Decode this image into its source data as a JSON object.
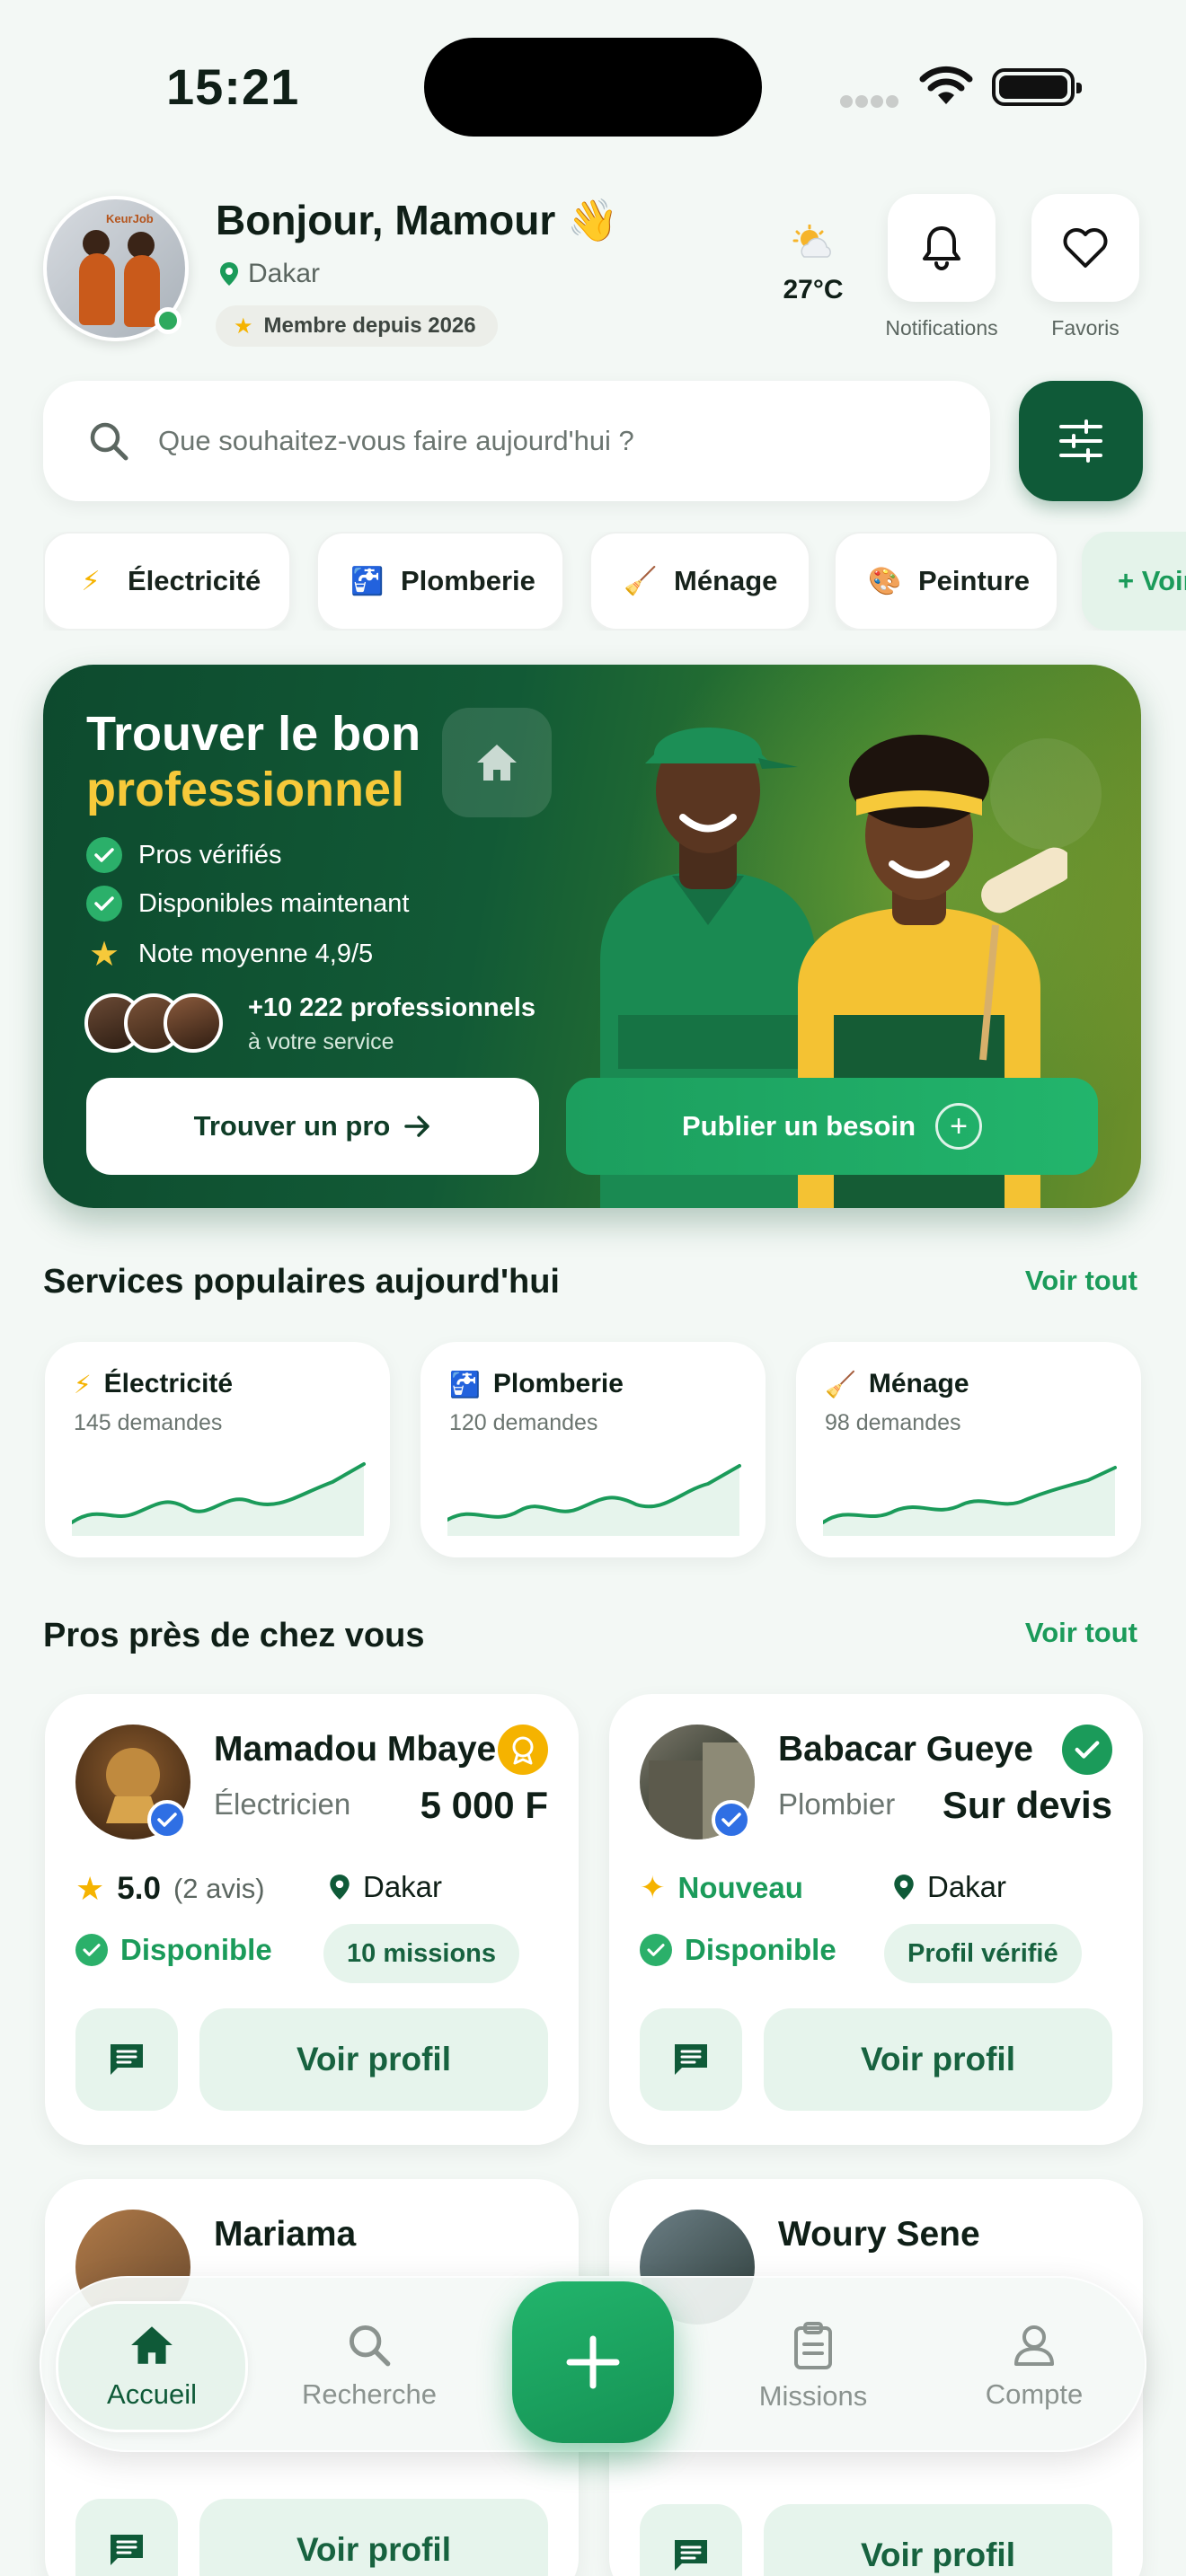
{
  "status_bar": {
    "time": "15:21"
  },
  "header": {
    "greeting": "Bonjour, Mamour 👋",
    "location": "Dakar",
    "member_badge": "Membre depuis 2026",
    "avatar_logo": "KeurJob",
    "weather": {
      "temp": "27°C",
      "icon": "partly-cloudy-icon"
    },
    "notifications_label": "Notifications",
    "favorites_label": "Favoris"
  },
  "search": {
    "placeholder": "Que souhaitez-vous faire aujourd'hui ?"
  },
  "categories": [
    {
      "icon": "⚡",
      "label": "Électricité"
    },
    {
      "icon": "🚰",
      "label": "Plomberie"
    },
    {
      "icon": "🧹",
      "label": "Ménage"
    },
    {
      "icon": "🎨",
      "label": "Peinture"
    },
    {
      "icon": "",
      "label": "+ Voir"
    }
  ],
  "hero": {
    "title_line1": "Trouver le bon",
    "title_line2": "professionnel",
    "features": [
      "Pros vérifiés",
      "Disponibles maintenant",
      "Note moyenne 4,9/5"
    ],
    "pros_count": "+10 222 professionnels",
    "pros_sub": "à votre service",
    "primary_button": "Trouver un pro",
    "secondary_button": "Publier un besoin"
  },
  "popular": {
    "title": "Services populaires aujourd'hui",
    "link": "Voir tout",
    "items": [
      {
        "icon": "⚡",
        "title": "Électricité",
        "requests": "145 demandes"
      },
      {
        "icon": "🚰",
        "title": "Plomberie",
        "requests": "120 demandes"
      },
      {
        "icon": "🧹",
        "title": "Ménage",
        "requests": "98 demandes"
      }
    ]
  },
  "nearby": {
    "title": "Pros près de chez vous",
    "link": "Voir tout",
    "pros": [
      {
        "name": "Mamadou Mbaye",
        "job": "Électricien",
        "price": "5 000 F",
        "rating": "5.0",
        "reviews": "(2 avis)",
        "city": "Dakar",
        "availability": "Disponible",
        "pill": "10 missions",
        "view": "Voir profil"
      },
      {
        "name": "Babacar Gueye",
        "job": "Plombier",
        "price": "Sur devis",
        "rating": "Nouveau",
        "city": "Dakar",
        "availability": "Disponible",
        "pill": "Profil vérifié",
        "view": "Voir profil"
      },
      {
        "name": "Mariama",
        "view": "Voir profil"
      },
      {
        "name": "Woury Sene",
        "view": "Voir profil"
      }
    ]
  },
  "bottom_nav": {
    "items": [
      {
        "label": "Accueil",
        "icon": "home-icon"
      },
      {
        "label": "Recherche",
        "icon": "search-icon"
      },
      {
        "label": "Missions",
        "icon": "clipboard-icon"
      },
      {
        "label": "Compte",
        "icon": "user-icon"
      }
    ],
    "fab_icon": "plus-icon"
  },
  "colors": {
    "brand_dark": "#0f5a38",
    "brand": "#1b9b5a",
    "accent_yellow": "#f6c93a",
    "background": "#f3f8f5"
  }
}
